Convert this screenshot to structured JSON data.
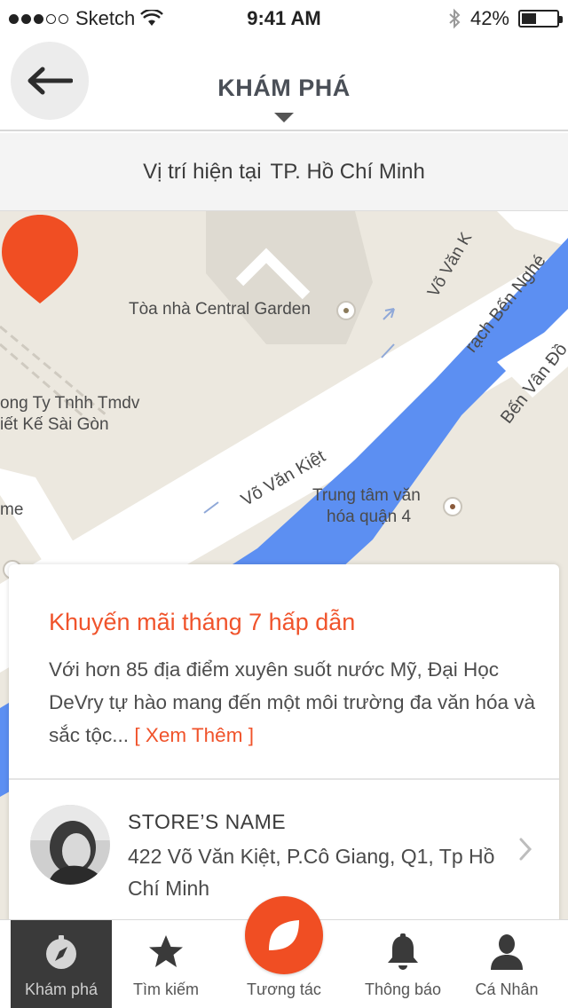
{
  "status_bar": {
    "carrier": "Sketch",
    "time": "9:41 AM",
    "battery": "42%",
    "battery_level": 0.42
  },
  "header": {
    "title": "KHÁM PHÁ",
    "back_icon": "arrow-left-icon"
  },
  "location": {
    "label": "Vị trí hiện tại",
    "city": "TP. Hồ Chí Minh"
  },
  "map": {
    "labels": {
      "central_garden": "Tòa nhà Central Garden",
      "vo_van_kiet_top": "Võ Văn K",
      "rach_ben_nghe": "rạch Bến Nghé",
      "ben_van_don": "Bến Vân Đồ",
      "company_line1": "ong Ty Tnhh Tmdv",
      "company_line2": "iết Kế Sài Gòn",
      "vo_van_kiet_mid": "Võ Văn Kiệt",
      "trung_tam_line1": "Trung tâm văn",
      "trung_tam_line2": "hóa quận 4",
      "me": "me"
    },
    "colors": {
      "land": "#ece8df",
      "road": "#ffffff",
      "water": "#5c8ff2",
      "building": "#dcd8cf",
      "pin": "#f04e23"
    }
  },
  "promo": {
    "title": "Khuyến mãi tháng 7 hấp dẫn",
    "body": "Với hơn 85 địa điểm xuyên suốt nước Mỹ, Đại Học DeVry tự hào mang đến một môi trường đa văn hóa và sắc tộc...",
    "more": "[ Xem Thêm ]"
  },
  "store": {
    "name": "STORE’S NAME",
    "address": "422 Võ Văn Kiệt, P.Cô Giang, Q1, Tp Hồ Chí Minh"
  },
  "tabs": [
    {
      "label": "Khám phá",
      "icon": "compass-icon",
      "active": true
    },
    {
      "label": "Tìm kiếm",
      "icon": "star-icon",
      "active": false
    },
    {
      "label": "Tương tác",
      "icon": "leaf-icon",
      "active": false
    },
    {
      "label": "Thông báo",
      "icon": "bell-icon",
      "active": false
    },
    {
      "label": "Cá Nhân",
      "icon": "person-icon",
      "active": false
    }
  ],
  "accent_color": "#f04e23"
}
